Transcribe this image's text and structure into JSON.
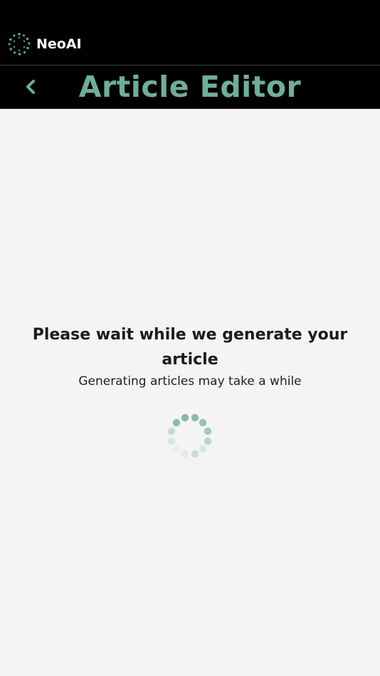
{
  "brand": {
    "name": "NeoAI",
    "logo_icon": "dotted-ring-logo-icon",
    "accent": "#6fae99"
  },
  "header": {
    "title": "Article Editor",
    "back_icon": "chevron-left-icon"
  },
  "loading": {
    "heading": "Please wait while we generate your article",
    "subtext": "Generating articles may take a while",
    "spinner_icon": "dot-spinner-icon"
  },
  "colors": {
    "header_bg": "#000000",
    "page_bg": "#f4f4f4",
    "accent": "#6fae99",
    "text_dark": "#1c1c1c"
  }
}
